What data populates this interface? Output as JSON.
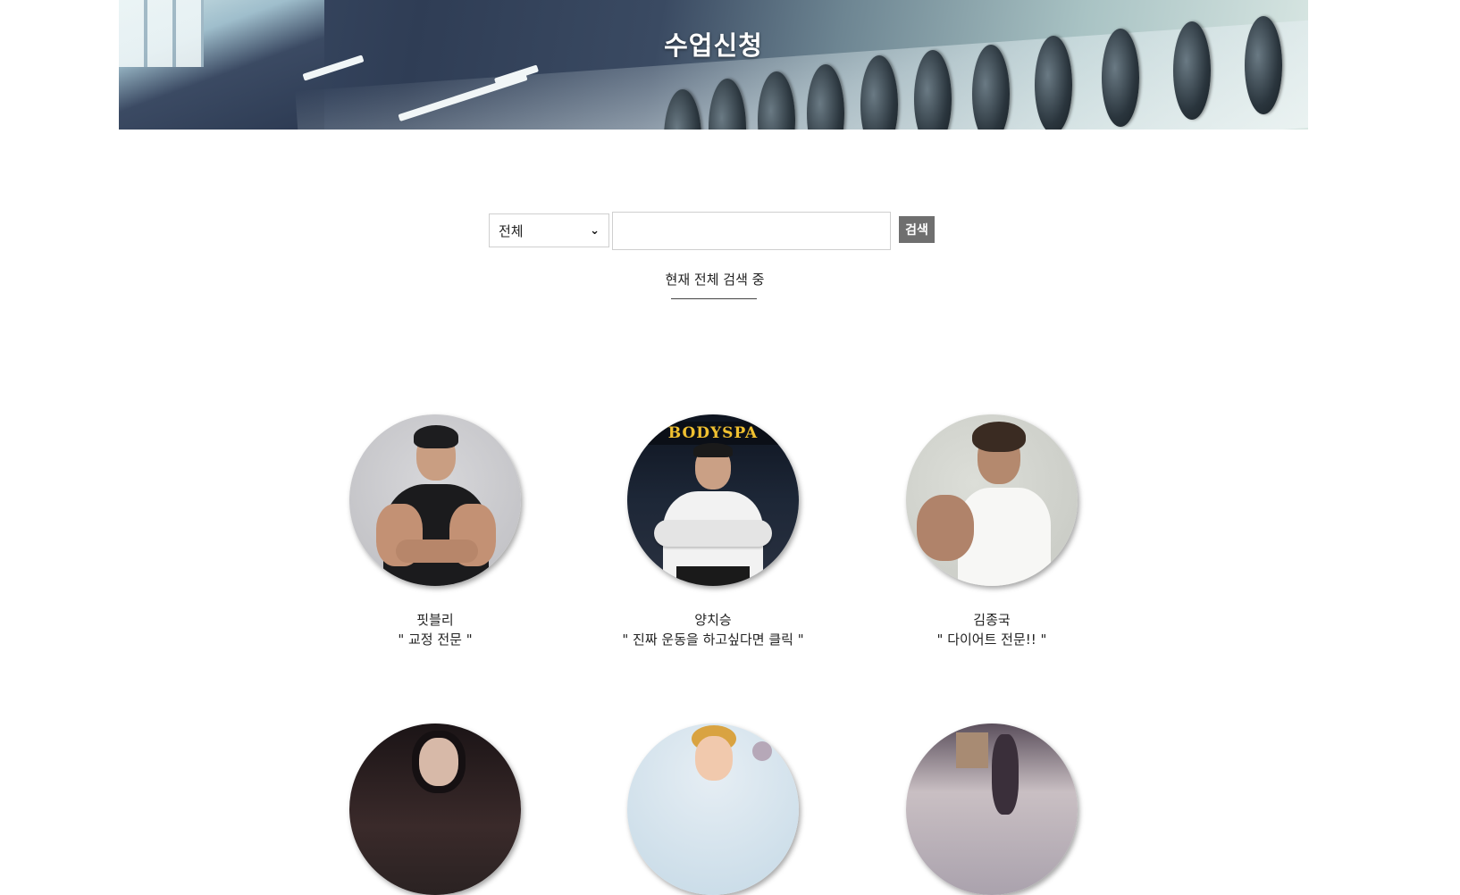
{
  "page": {
    "title": "수업신청"
  },
  "search": {
    "category_selected": "전체",
    "query_value": "",
    "button_label": "검색",
    "status_text": "현재 전체 검색 중"
  },
  "trainers": [
    {
      "name": "핏블리",
      "description": "\" 교정 전문 \""
    },
    {
      "name": "양치승",
      "description": "\" 진짜 운동을 하고싶다면 클릭 \""
    },
    {
      "name": "김종국",
      "description": "\" 다이어트 전문!! \""
    }
  ],
  "trainer_photos": [
    {
      "sign_text": "BODYSPA"
    }
  ],
  "colors": {
    "button_bg": "#6f6f6f",
    "hero_overlay_text": "#ffffff"
  },
  "icons": {
    "select_arrow": "chevron-down-icon"
  }
}
